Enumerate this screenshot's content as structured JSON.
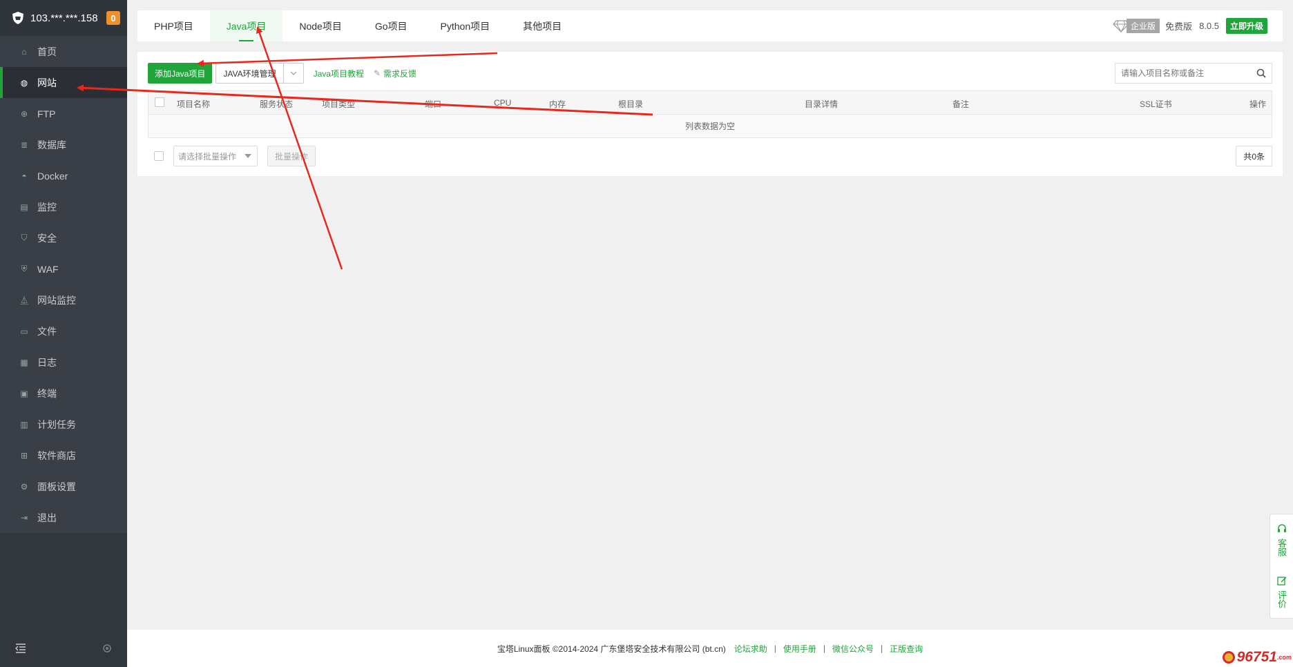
{
  "sidebar": {
    "server_ip": "103.***.***.158",
    "badge": "0",
    "items": [
      {
        "label": "首页",
        "icon": "home-icon"
      },
      {
        "label": "网站",
        "icon": "globe-icon"
      },
      {
        "label": "FTP",
        "icon": "ftp-icon"
      },
      {
        "label": "数据库",
        "icon": "database-icon"
      },
      {
        "label": "Docker",
        "icon": "docker-icon"
      },
      {
        "label": "监控",
        "icon": "monitor-icon"
      },
      {
        "label": "安全",
        "icon": "shield-icon"
      },
      {
        "label": "WAF",
        "icon": "waf-icon"
      },
      {
        "label": "网站监控",
        "icon": "site-monitor-icon"
      },
      {
        "label": "文件",
        "icon": "folder-icon"
      },
      {
        "label": "日志",
        "icon": "log-icon"
      },
      {
        "label": "终端",
        "icon": "terminal-icon"
      },
      {
        "label": "计划任务",
        "icon": "calendar-icon"
      },
      {
        "label": "软件商店",
        "icon": "store-icon"
      },
      {
        "label": "面板设置",
        "icon": "gear-icon"
      },
      {
        "label": "退出",
        "icon": "logout-icon"
      }
    ],
    "active_index": 1
  },
  "tabs": [
    "PHP项目",
    "Java项目",
    "Node项目",
    "Go项目",
    "Python项目",
    "其他项目"
  ],
  "active_tab": 1,
  "top_right": {
    "edition_label": "企业版",
    "free_label": "免费版",
    "version": "8.0.5",
    "upgrade_label": "立即升级"
  },
  "toolbar": {
    "add_label": "添加Java项目",
    "env_label": "JAVA环境管理",
    "tutorial_label": "Java项目教程",
    "feedback_label": "需求反馈",
    "search_placeholder": "请输入项目名称或备注"
  },
  "table": {
    "columns": [
      "项目名称",
      "服务状态",
      "项目类型",
      "端口",
      "CPU",
      "内存",
      "根目录",
      "目录详情",
      "备注",
      "SSL证书",
      "操作"
    ],
    "empty_text": "列表数据为空"
  },
  "bottom": {
    "batch_placeholder": "请选择批量操作",
    "batch_button": "批量操作",
    "total": "共0条"
  },
  "footer": {
    "copyright": "宝塔Linux面板 ©2014-2024 广东堡塔安全技术有限公司 (bt.cn)",
    "links": [
      "论坛求助",
      "使用手册",
      "微信公众号",
      "正版查询"
    ]
  },
  "float_widget": {
    "service": "客服",
    "review": "评价"
  },
  "watermark": {
    "text": "96751",
    "suffix": ".com"
  },
  "colors": {
    "accent": "#20a53a",
    "sidebar_bg": "#3a3f47",
    "annotation": "#e8281c"
  }
}
